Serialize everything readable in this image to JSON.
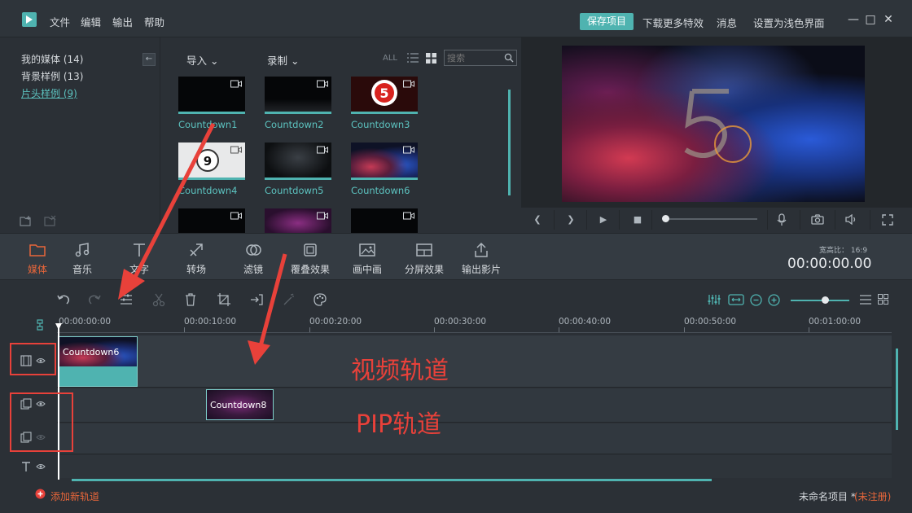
{
  "menu": {
    "file": "文件",
    "edit": "编辑",
    "export": "输出",
    "help": "帮助"
  },
  "topbar": {
    "save_project": "保存项目",
    "download_effects": "下载更多特效",
    "messages": "消息",
    "light_theme": "设置为浅色界面"
  },
  "library": {
    "my_media": "我的媒体 (14)",
    "backgrounds": "背景样例 (13)",
    "intros": "片头样例 (9)",
    "collapse": "←"
  },
  "media_bin": {
    "import": "导入",
    "record": "录制",
    "all": "ALL",
    "search_placeholder": "搜索",
    "clips": [
      {
        "label": "Countdown1"
      },
      {
        "label": "Countdown2"
      },
      {
        "label": "Countdown3"
      },
      {
        "label": "Countdown4"
      },
      {
        "label": "Countdown5"
      },
      {
        "label": "Countdown6"
      },
      {
        "label": ""
      },
      {
        "label": ""
      },
      {
        "label": ""
      }
    ]
  },
  "toolbar": {
    "media": "媒体",
    "music": "音乐",
    "text": "文字",
    "transition": "转场",
    "filter": "滤镜",
    "overlay": "覆叠效果",
    "pip": "画中画",
    "split": "分屏效果",
    "export": "输出影片",
    "ratio_label": "宽高比：  16:9",
    "timecode": "00:00:00.00"
  },
  "ruler": {
    "ticks": [
      "00:00:00:00",
      "00:00:10:00",
      "00:00:20:00",
      "00:00:30:00",
      "00:00:40:00",
      "00:00:50:00",
      "00:01:00:00"
    ]
  },
  "timeline": {
    "video_clip": "Countdown6",
    "pip_clip": "Countdown8"
  },
  "annotations": {
    "video_track": "视频轨道",
    "pip_track": "PIP轨道"
  },
  "status": {
    "add_track": "添加新轨道",
    "project_name": "未命名项目 *",
    "unregistered": "(未注册)"
  },
  "colors": {
    "accent": "#4fb3b0",
    "active": "#e8663a",
    "annotation": "#e8413a",
    "background": "#2b3036"
  }
}
